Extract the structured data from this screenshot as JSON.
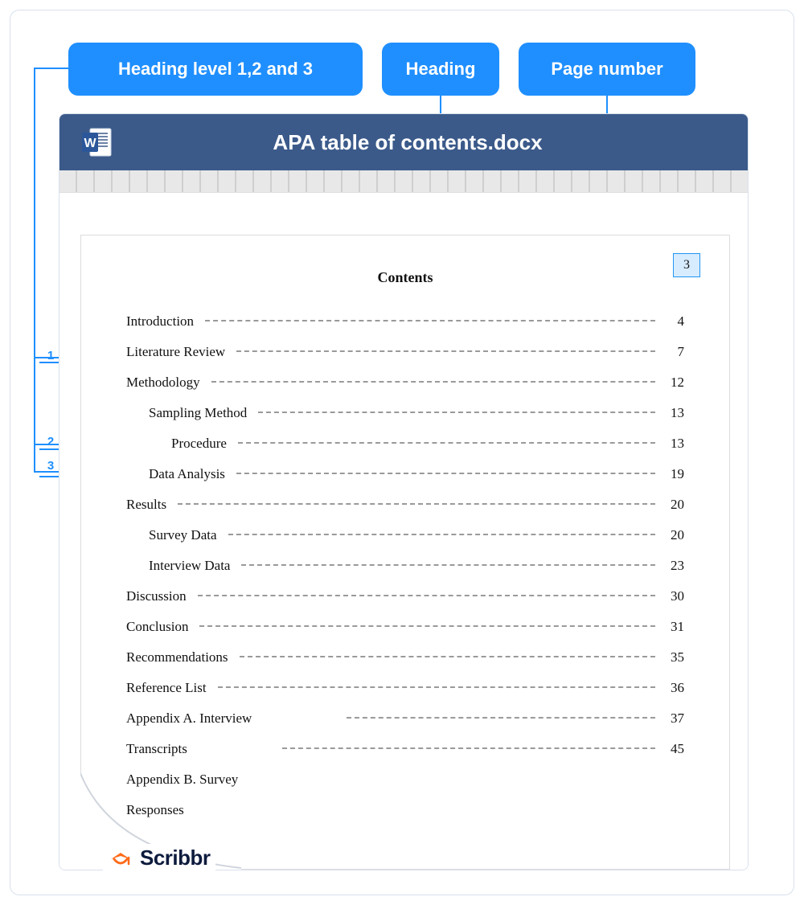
{
  "callouts": {
    "levels": "Heading level 1,2 and 3",
    "heading": "Heading",
    "pagenum": "Page number"
  },
  "document": {
    "filename": "APA table of contents.docx",
    "page_number": "3",
    "contents_title": "Contents"
  },
  "level_markers": {
    "l1": "1",
    "l2": "2",
    "l3": "3"
  },
  "toc": [
    {
      "label": "Introduction",
      "page": "4",
      "level": 1
    },
    {
      "label": "Literature Review",
      "page": "7",
      "level": 1
    },
    {
      "label": "Methodology",
      "page": "12",
      "level": 1
    },
    {
      "label": "Sampling Method",
      "page": "13",
      "level": 2
    },
    {
      "label": "Procedure",
      "page": "13",
      "level": 3
    },
    {
      "label": "Data Analysis",
      "page": "19",
      "level": 2
    },
    {
      "label": "Results",
      "page": "20",
      "level": 1
    },
    {
      "label": "Survey Data",
      "page": "20",
      "level": 2
    },
    {
      "label": "Interview Data",
      "page": "23",
      "level": 2
    },
    {
      "label": "Discussion",
      "page": "30",
      "level": 1
    },
    {
      "label": "Conclusion",
      "page": "31",
      "level": 1
    },
    {
      "label": "Recommendations",
      "page": "35",
      "level": 1
    },
    {
      "label": "Reference List",
      "page": "36",
      "level": 1
    },
    {
      "label": "Appendix A. Interview",
      "page": "37",
      "level": 1,
      "special": true
    },
    {
      "label": "Transcripts",
      "page": "45",
      "level": 1,
      "special": true
    },
    {
      "label": "Appendix B. Survey",
      "page": "",
      "level": 1,
      "nolead": true
    },
    {
      "label": "Responses",
      "page": "",
      "level": 1,
      "nolead": true
    }
  ],
  "brand": "Scribbr"
}
